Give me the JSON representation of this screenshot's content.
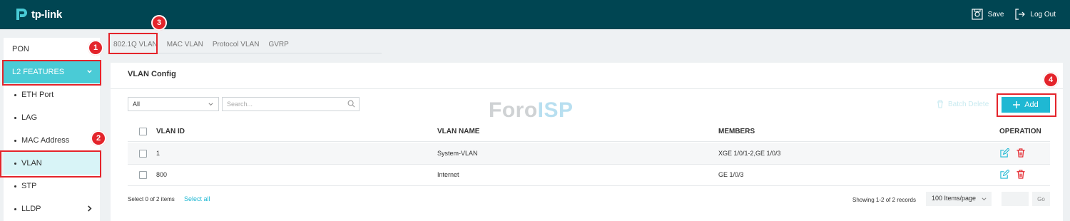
{
  "header": {
    "brand": "tp-link",
    "save_label": "Save",
    "logout_label": "Log Out",
    "bg_color": "#004552"
  },
  "sidebar": {
    "items": [
      {
        "label": "PON",
        "type": "top"
      },
      {
        "label": "L2 FEATURES",
        "type": "group",
        "expanded": true
      },
      {
        "label": "ETH Port",
        "type": "sub"
      },
      {
        "label": "LAG",
        "type": "sub"
      },
      {
        "label": "MAC Address",
        "type": "sub"
      },
      {
        "label": "VLAN",
        "type": "sub",
        "active": true
      },
      {
        "label": "STP",
        "type": "sub"
      },
      {
        "label": "LLDP",
        "type": "sub",
        "has_children": true
      }
    ],
    "accent_color": "#4acbd6"
  },
  "tabs": [
    "802.1Q VLAN",
    "MAC VLAN",
    "Protocol VLAN",
    "GVRP"
  ],
  "annotations": [
    "1",
    "2",
    "3",
    "4"
  ],
  "panel": {
    "title": "VLAN Config",
    "filter_value": "All",
    "search_placeholder": "Search...",
    "batch_delete_label": "Batch Delete",
    "add_label": "Add"
  },
  "watermark": {
    "part1": "Foro",
    "part2": "ISP"
  },
  "table": {
    "columns": [
      "VLAN ID",
      "VLAN NAME",
      "MEMBERS",
      "OPERATION"
    ],
    "rows": [
      {
        "id": "1",
        "name": "System-VLAN",
        "members": "XGE 1/0/1-2,GE 1/0/3"
      },
      {
        "id": "800",
        "name": "Internet",
        "members": "GE 1/0/3"
      }
    ]
  },
  "footer": {
    "selected": "Select 0 of 2 items",
    "select_all": "Select all",
    "showing": "Showing 1-2 of 2 records",
    "per_page": "100 Items/page",
    "go": "Go"
  },
  "colors": {
    "highlight": "#e4242b",
    "primary": "#1fb8d3",
    "delete": "#e4242b"
  }
}
